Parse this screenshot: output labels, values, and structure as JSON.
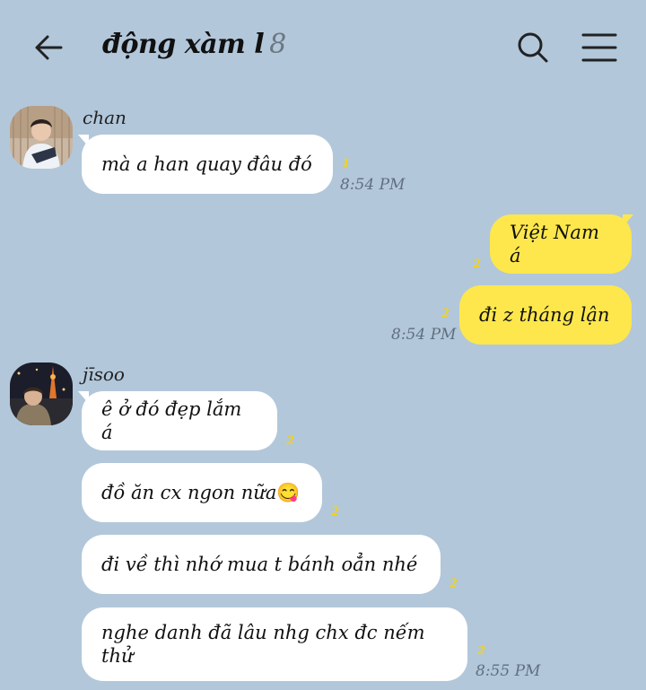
{
  "header": {
    "title": "động xàm l",
    "member_count": "8",
    "back_icon": "arrow-left-icon",
    "search_icon": "search-icon",
    "menu_icon": "hamburger-menu-icon"
  },
  "colors": {
    "background": "#b2c7da",
    "incoming_bubble": "#ffffff",
    "outgoing_bubble": "#fde74c",
    "unread": "#f2d21b",
    "timestamp": "#5f6f80"
  },
  "messages": {
    "chan": {
      "sender": "chan",
      "text": "mà a han quay đâu đó",
      "unread": "1",
      "time": "8:54 PM"
    },
    "me": {
      "msg1": {
        "text": "Việt Nam á",
        "unread": "2"
      },
      "msg2": {
        "text": "đi z tháng lận",
        "unread": "2",
        "time": "8:54 PM"
      }
    },
    "jisoo": {
      "sender": "jīsoo",
      "msg1": {
        "text": "ê ở đó đẹp lắm á",
        "unread": "2"
      },
      "msg2": {
        "text": "đồ ăn cx ngon nữa",
        "emoji": "😋",
        "unread": "2"
      },
      "msg3": {
        "text": "đi về thì nhớ mua t bánh oẳn nhé",
        "unread": "2"
      },
      "msg4": {
        "text": "nghe danh đã lâu nhg chx đc nếm thử",
        "unread": "2",
        "time": "8:55 PM"
      }
    }
  }
}
